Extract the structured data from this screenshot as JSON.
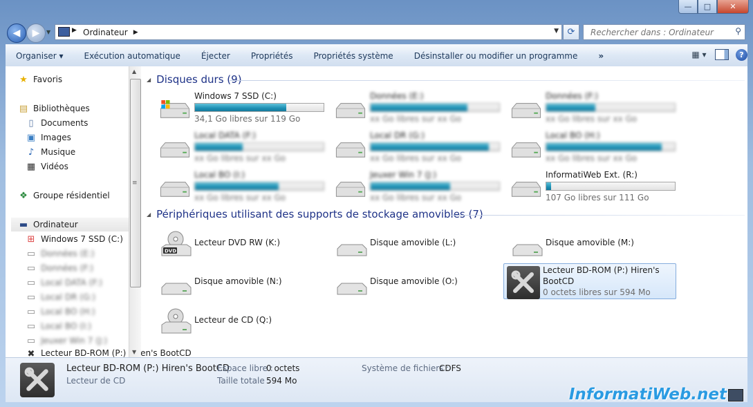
{
  "window": {
    "min": "—",
    "max": "□",
    "close": "✕"
  },
  "address": {
    "crumb": "Ordinateur",
    "refresh_icon": "refresh-icon"
  },
  "search": {
    "placeholder": "Rechercher dans : Ordinateur"
  },
  "toolbar": {
    "items": [
      "Organiser ▾",
      "Exécution automatique",
      "Éjecter",
      "Propriétés",
      "Propriétés système",
      "Désinstaller ou modifier un programme",
      "»"
    ]
  },
  "nav": {
    "favoris": "Favoris",
    "bibliotheques": "Bibliothèques",
    "documents": "Documents",
    "images": "Images",
    "musique": "Musique",
    "videos": "Vidéos",
    "groupe": "Groupe résidentiel",
    "ordinateur": "Ordinateur",
    "win7": "Windows 7 SSD (C:)",
    "blurred": [
      "Données (E:)",
      "Données (F:)",
      "Local DATA (F:)",
      "Local DR (G:)",
      "Local BO (H:)",
      "Local BO (I:)",
      "Jeuxer Win 7 (J:)"
    ],
    "bdrom": "Lecteur BD-ROM (P:) Hiren's BootCD"
  },
  "groups": {
    "hdd_title": "Disques durs (9)",
    "removable_title": "Périphériques utilisant des supports de stockage amovibles (7)"
  },
  "drives": [
    {
      "name": "Windows 7 SSD (C:)",
      "free": "34,1 Go libres sur 119 Go",
      "fill": 0.71,
      "blurred": false
    },
    {
      "name": "Données (E:)",
      "free": "xx Go libres sur xx Go",
      "fill": 0.75,
      "blurred": true
    },
    {
      "name": "Données (F:)",
      "free": "xx Go libres sur xx Go",
      "fill": 0.38,
      "blurred": true
    },
    {
      "name": "Local DATA (F:)",
      "free": "xx Go libres sur xx Go",
      "fill": 0.37,
      "blurred": true
    },
    {
      "name": "Local DR (G:)",
      "free": "xx Go libres sur xx Go",
      "fill": 0.92,
      "blurred": true
    },
    {
      "name": "Local BO (H:)",
      "free": "xx Go libres sur xx Go",
      "fill": 0.9,
      "blurred": true
    },
    {
      "name": "Local BO (I:)",
      "free": "xx Go libres sur xx Go",
      "fill": 0.65,
      "blurred": true
    },
    {
      "name": "Jeuxer Win 7 (J:)",
      "free": "xx Go libres sur xx Go",
      "fill": 0.62,
      "blurred": true
    },
    {
      "name": "InformatiWeb Ext. (R:)",
      "free": "107 Go libres sur 111 Go",
      "fill": 0.04,
      "blurred": false
    }
  ],
  "devices": [
    {
      "name": "Lecteur DVD RW (K:)"
    },
    {
      "name": "Disque amovible (L:)"
    },
    {
      "name": "Disque amovible (M:)"
    },
    {
      "name": "Disque amovible (N:)"
    },
    {
      "name": "Disque amovible (O:)"
    },
    {
      "name": "Lecteur BD-ROM (P:) Hiren's",
      "name2": "BootCD",
      "free": "0 octets libres sur 594 Mo"
    },
    {
      "name": "Lecteur de CD (Q:)"
    }
  ],
  "details": {
    "title": "Lecteur BD-ROM (P:) Hiren's BootCD",
    "type": "Lecteur de CD",
    "free_label": "Espace libre :",
    "free_value": "0 octets",
    "total_label": "Taille totale :",
    "total_value": "594 Mo",
    "fs_label": "Système de fichiers :",
    "fs_value": "CDFS"
  },
  "watermark": "InformatiWeb.net"
}
